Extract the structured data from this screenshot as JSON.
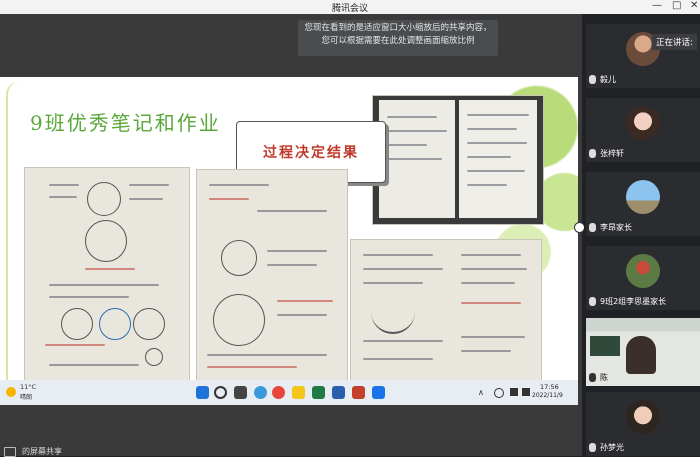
{
  "window": {
    "title": "腾讯会议"
  },
  "toast": {
    "text": "您现在看到的是适应窗口大小缩放后的共享内容，您可以根据需要在此处调整画面缩放比例"
  },
  "slide": {
    "title": "9班优秀笔记和作业",
    "bubble_text": "过程决定结果"
  },
  "taskbar": {
    "weather_temp": "11°C",
    "weather_desc": "晴朗",
    "time": "17:56",
    "date": "2022/11/9"
  },
  "sidebar": {
    "speaking_label": "正在讲话:",
    "participants": [
      {
        "name": "毅儿"
      },
      {
        "name": "张梓轩"
      },
      {
        "name": "李昂家长"
      },
      {
        "name": "9班2组李思墨家长"
      },
      {
        "name": "陈"
      },
      {
        "name": "孙梦光"
      }
    ]
  },
  "footer": {
    "share_label": "的屏幕共享"
  }
}
